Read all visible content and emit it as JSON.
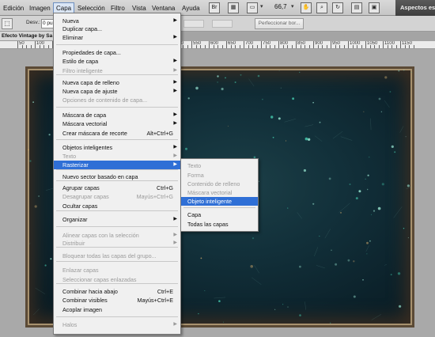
{
  "menubar": {
    "items": [
      "Edición",
      "Imagen",
      "Capa",
      "Selección",
      "Filtro",
      "Vista",
      "Ventana",
      "Ayuda"
    ],
    "zoom": "66,7",
    "workspace": "Aspectos es"
  },
  "options_bar": {
    "label": "Desv.:",
    "input_value": "0 pu",
    "refine_label": "Perfeccionar bor..."
  },
  "document": {
    "tab_title": "Efecto Vintage by Sa",
    "ruler_ticks": [
      "50",
      "100",
      "150",
      "200",
      "250",
      "300",
      "350",
      "400",
      "450",
      "500",
      "550",
      "600",
      "650",
      "700",
      "750",
      "800",
      "850",
      "900",
      "950",
      "1000",
      "1050",
      "1100",
      "1150"
    ]
  },
  "layer_menu": {
    "items": [
      {
        "label": "Nueva",
        "arrow": true
      },
      {
        "label": "Duplicar capa..."
      },
      {
        "label": "Eliminar",
        "arrow": true
      },
      {
        "label": "Propiedades de capa..."
      },
      {
        "label": "Estilo de capa",
        "arrow": true
      },
      {
        "label": "Filtro inteligente",
        "disabled": true,
        "arrow": true
      },
      {
        "label": "Nueva capa de relleno",
        "arrow": true
      },
      {
        "label": "Nueva capa de ajuste",
        "arrow": true
      },
      {
        "label": "Opciones de contenido de capa...",
        "disabled": true
      },
      {
        "label": "Máscara de capa",
        "arrow": true
      },
      {
        "label": "Máscara vectorial",
        "arrow": true
      },
      {
        "label": "Crear máscara de recorte",
        "shortcut": "Alt+Ctrl+G"
      },
      {
        "label": "Objetos inteligentes",
        "arrow": true
      },
      {
        "label": "Texto",
        "disabled": true,
        "arrow": true
      },
      {
        "label": "Rasterizar",
        "arrow": true,
        "highlight": true
      },
      {
        "label": "Nuevo sector basado en capa"
      },
      {
        "label": "Agrupar capas",
        "shortcut": "Ctrl+G"
      },
      {
        "label": "Desagrupar capas",
        "shortcut": "Mayús+Ctrl+G",
        "disabled": true
      },
      {
        "label": "Ocultar capas"
      },
      {
        "label": "Organizar",
        "arrow": true
      },
      {
        "label": "Alinear capas con la selección",
        "disabled": true,
        "arrow": true
      },
      {
        "label": "Distribuir",
        "disabled": true,
        "arrow": true
      },
      {
        "label": "Bloquear todas las capas del grupo...",
        "disabled": true
      },
      {
        "label": "Enlazar capas",
        "disabled": true
      },
      {
        "label": "Seleccionar capas enlazadas",
        "disabled": true
      },
      {
        "label": "Combinar hacia abajo",
        "shortcut": "Ctrl+E"
      },
      {
        "label": "Combinar visibles",
        "shortcut": "Mayús+Ctrl+E"
      },
      {
        "label": "Acoplar imagen"
      },
      {
        "label": "Halos",
        "disabled": true,
        "arrow": true
      }
    ]
  },
  "rasterize_menu": {
    "items": [
      {
        "label": "Texto",
        "disabled": true
      },
      {
        "label": "Forma",
        "disabled": true
      },
      {
        "label": "Contenido de relleno",
        "disabled": true
      },
      {
        "label": "Máscara vectorial",
        "disabled": true
      },
      {
        "label": "Objeto inteligente",
        "highlight": true
      },
      {
        "label": "Capa"
      },
      {
        "label": "Todas las capas"
      }
    ]
  }
}
